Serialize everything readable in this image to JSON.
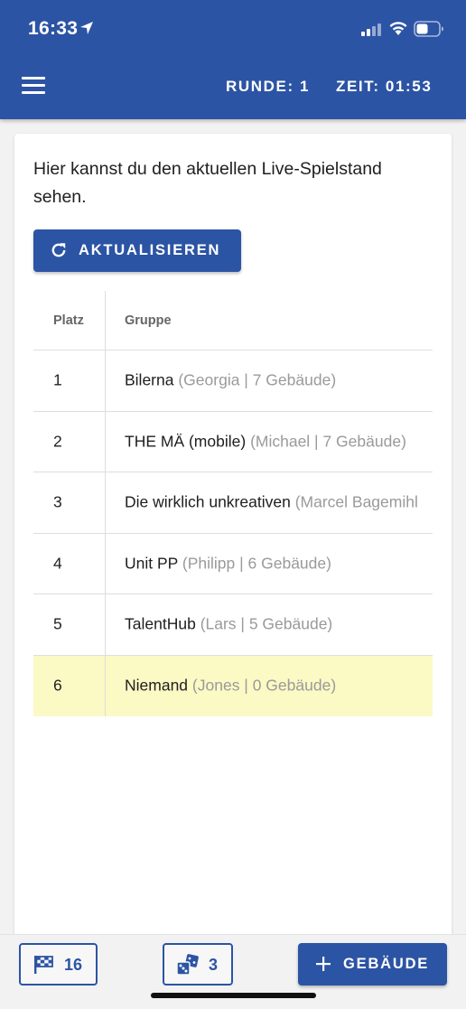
{
  "status_bar": {
    "time": "16:33",
    "icons": [
      "location-arrow-icon",
      "cellular-signal-icon",
      "wifi-icon",
      "battery-icon"
    ]
  },
  "header": {
    "menu_icon": "hamburger-menu-icon",
    "round": "RUNDE: 1",
    "time": "ZEIT: 01:53",
    "bg_color": "#2c54a4"
  },
  "card": {
    "intro": "Hier kannst du den aktuellen Live-Spielstand sehen.",
    "refresh_button": "AKTUALISIEREN",
    "refresh_icon": "refresh-icon"
  },
  "table": {
    "columns": [
      "Platz",
      "Gruppe"
    ],
    "rows": [
      {
        "rank": "1",
        "name": "Bilerna",
        "meta": "(Georgia | 7 Gebäude)"
      },
      {
        "rank": "2",
        "name": "THE MÄ (mobile)",
        "meta": "(Michael | 7 Gebäude)"
      },
      {
        "rank": "3",
        "name": "Die wirklich unkreativen",
        "meta": "(Marcel Bagemihl"
      },
      {
        "rank": "4",
        "name": "Unit PP",
        "meta": "(Philipp | 6 Gebäude)"
      },
      {
        "rank": "5",
        "name": "TalentHub",
        "meta": "(Lars | 5 Gebäude)"
      },
      {
        "rank": "6",
        "name": "Niemand",
        "meta": "(Jones | 0 Gebäude)"
      }
    ],
    "highlight_color": "#fbf9c4"
  },
  "bottom_bar": {
    "flag_count": "16",
    "flag_icon": "checkered-flag-icon",
    "dice_count": "3",
    "dice_icon": "dice-icon",
    "add_label": "GEBÄUDE",
    "add_icon": "plus-icon"
  }
}
